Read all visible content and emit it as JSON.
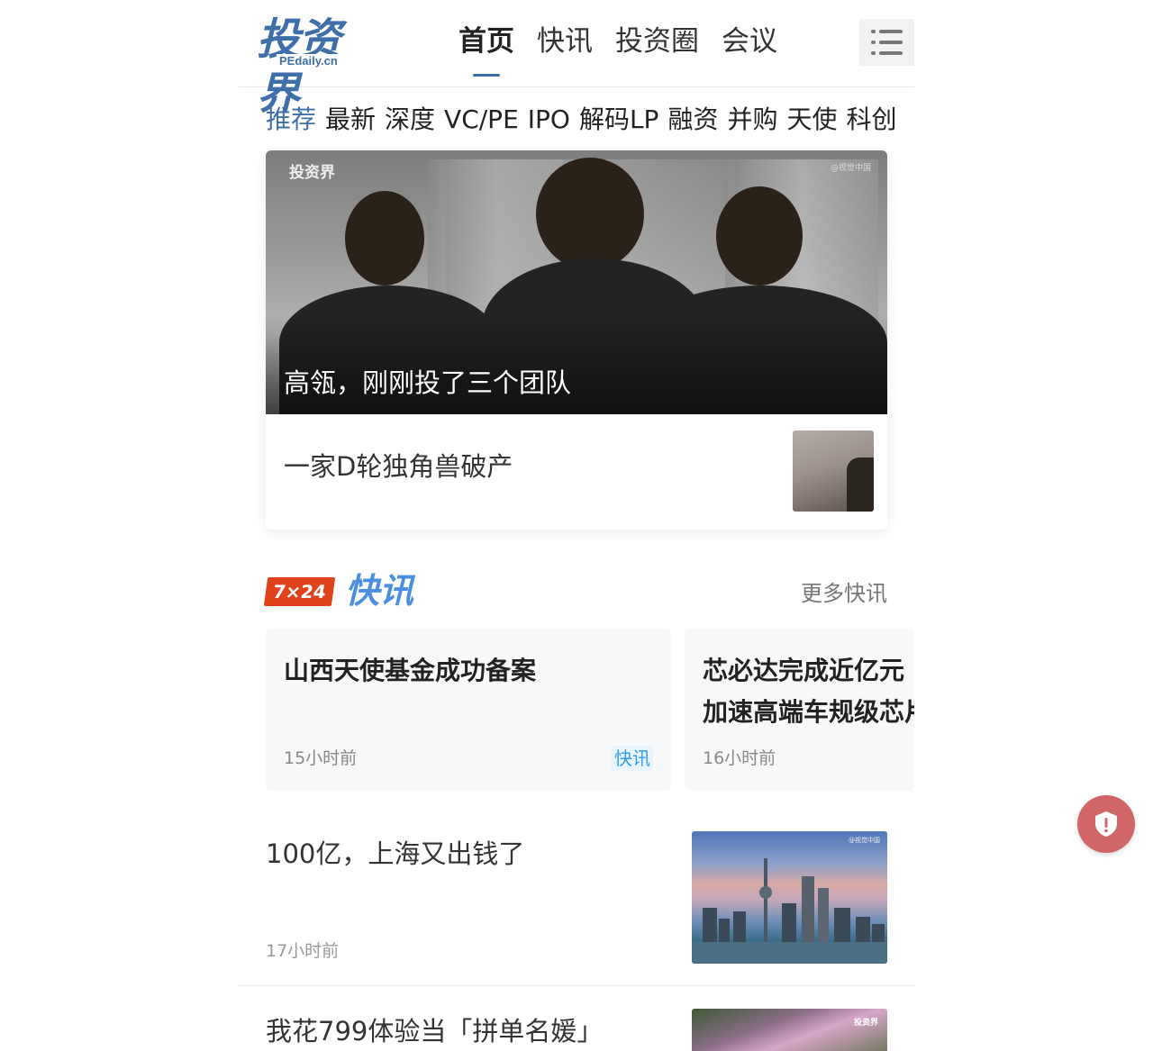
{
  "header": {
    "logo_cn": "投资界",
    "logo_en": "PEdaily.cn",
    "nav": [
      {
        "label": "首页",
        "active": true
      },
      {
        "label": "快讯",
        "active": false
      },
      {
        "label": "投资圈",
        "active": false
      },
      {
        "label": "会议",
        "active": false
      }
    ],
    "menu_icon": "hamburger-menu-icon"
  },
  "categories": [
    "推荐",
    "最新",
    "深度",
    "VC/PE",
    "IPO",
    "解码LP",
    "融资",
    "并购",
    "天使",
    "科创"
  ],
  "categories_active": "推荐",
  "featured": {
    "hero_title": "高瓴，刚刚投了三个团队",
    "hero_watermark": "投资界",
    "hero_credit": "@视觉中国",
    "sub_title": "一家D轮独角兽破产"
  },
  "flash": {
    "badge": "7×24",
    "title": "快讯",
    "more_label": "更多快讯",
    "cards": [
      {
        "title_lines": [
          "山西天使基金成功备案"
        ],
        "time": "15小时前",
        "tag": "快讯"
      },
      {
        "title_lines": [
          "芯必达完成近亿元",
          "加速高端车规级芯片"
        ],
        "time": "16小时前",
        "tag": ""
      }
    ]
  },
  "articles": [
    {
      "title": "100亿，上海又出钱了",
      "time": "17小时前",
      "image_credit": "@视觉中国"
    },
    {
      "title": "我花799体验当「拼单名媛」",
      "time": "",
      "image_credit": "投资界"
    }
  ],
  "colors": {
    "brand": "#3e6fa8",
    "flash_badge": "#e0431c",
    "flash_title": "#4a8fe0",
    "tag_text": "#2e9cf0",
    "shield_button": "#d06666"
  },
  "floating": {
    "icon": "shield-alert-icon"
  }
}
